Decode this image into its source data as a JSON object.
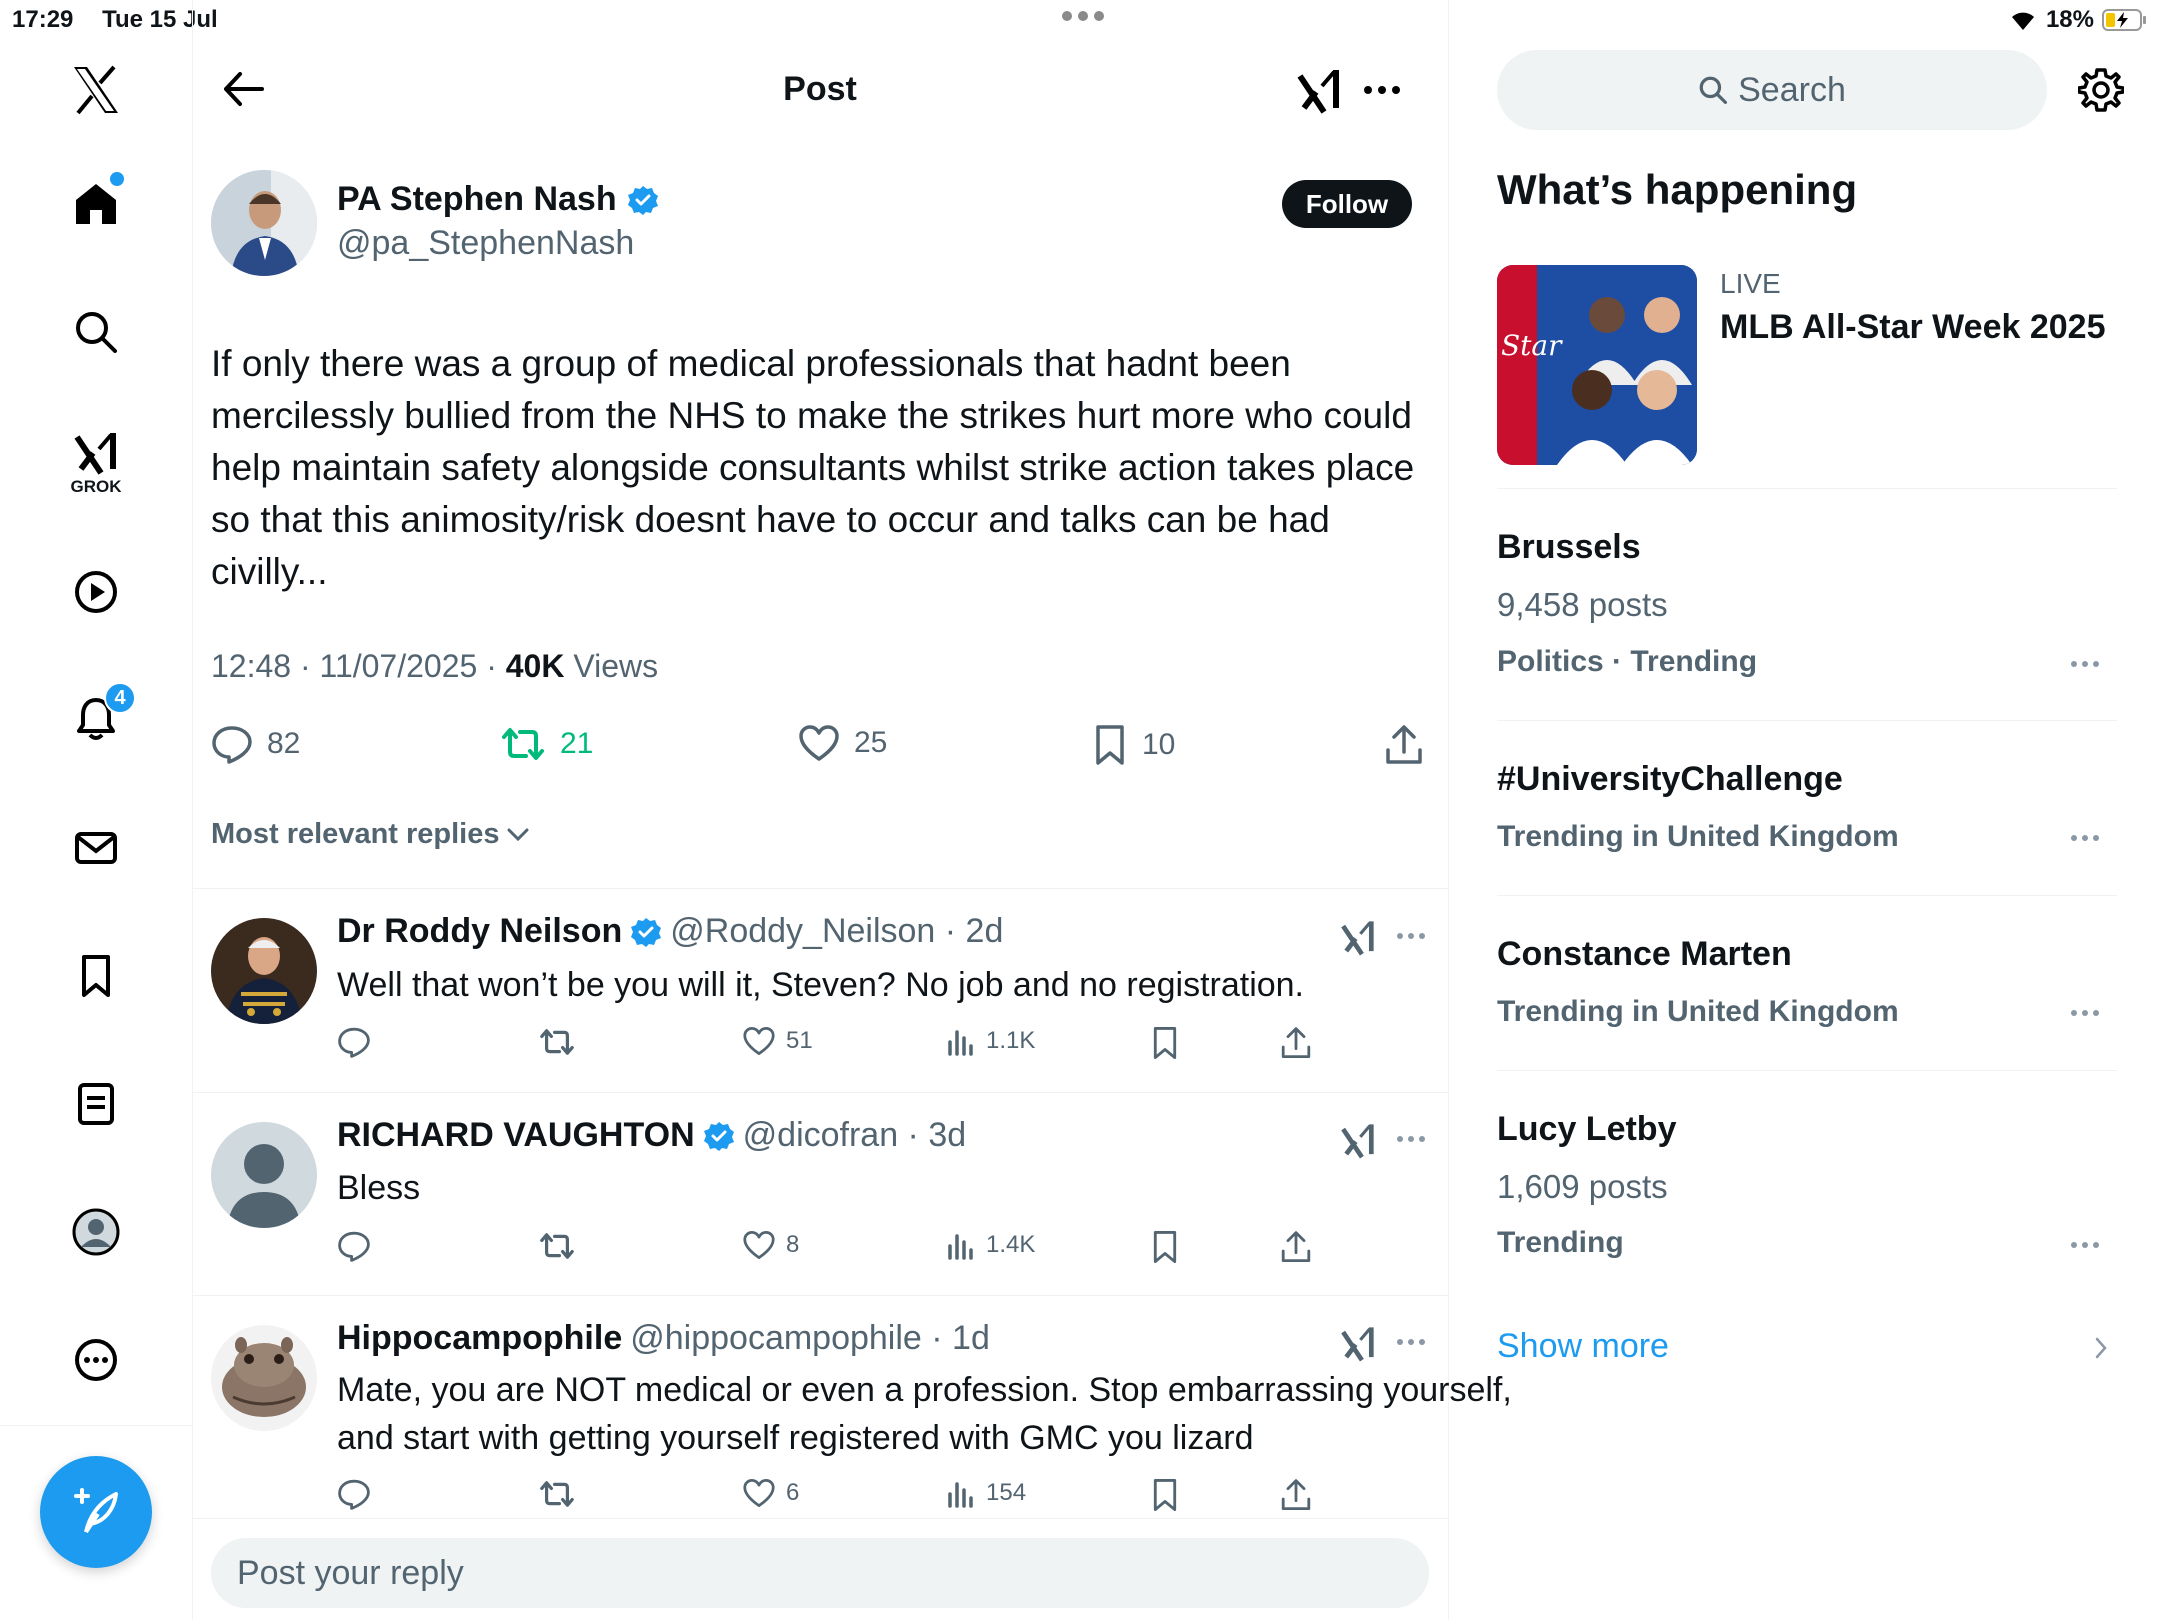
{
  "status_bar": {
    "time": "17:29",
    "date": "Tue 15 Jul",
    "battery": "18%"
  },
  "nav": {
    "grok_label": "GROK",
    "notifications_count": "4"
  },
  "header": {
    "title": "Post"
  },
  "post": {
    "author_name": "PA Stephen Nash",
    "author_handle": "@pa_StephenNash",
    "follow_label": "Follow",
    "text": "If only there was a group of medical professionals that hadnt been mercilessly bullied from the NHS to make the strikes hurt more who could help maintain safety alongside consultants whilst strike action takes place so that this animosity/risk doesnt have to occur and talks can be had civilly...",
    "timestamp": "12:48 · 11/07/2025 · ",
    "views_count": "40K",
    "views_label": " Views",
    "replies": "82",
    "reposts": "21",
    "likes": "25",
    "bookmarks": "10",
    "sort_label": "Most relevant replies"
  },
  "replies": [
    {
      "name": "Dr Roddy Neilson",
      "handle": "@Roddy_Neilson · 2d",
      "text": "Well that won’t be you will it, Steven? No job and no registration.",
      "likes": "51",
      "views": "1.1K"
    },
    {
      "name": "RICHARD VAUGHTON",
      "handle": "@dicofran · 3d",
      "text": "Bless",
      "likes": "8",
      "views": "1.4K"
    },
    {
      "name": "Hippocampophile",
      "handle": "@hippocampophile · 1d",
      "text": "Mate, you are NOT medical or even a profession. Stop embarrassing yourself, and start with getting yourself registered with GMC you lizard",
      "likes": "6",
      "views": "154"
    }
  ],
  "reply_box": {
    "placeholder": "Post your reply"
  },
  "sidebar": {
    "search_placeholder": "Search",
    "section_title": "What’s happening",
    "live_label": "LIVE",
    "live_title": "MLB All-Star Week 2025",
    "trends": [
      {
        "name": "Brussels",
        "count": "9,458 posts",
        "category": "Politics · Trending"
      },
      {
        "name": "#UniversityChallenge",
        "count": "",
        "category": "Trending in United Kingdom"
      },
      {
        "name": "Constance Marten",
        "count": "",
        "category": "Trending in United Kingdom"
      },
      {
        "name": "Lucy Letby",
        "count": "1,609 posts",
        "category": "Trending"
      }
    ],
    "show_more": "Show more"
  },
  "colors": {
    "accent": "#1d9bf0",
    "repost_active": "#00ba7c",
    "muted": "#536471"
  }
}
